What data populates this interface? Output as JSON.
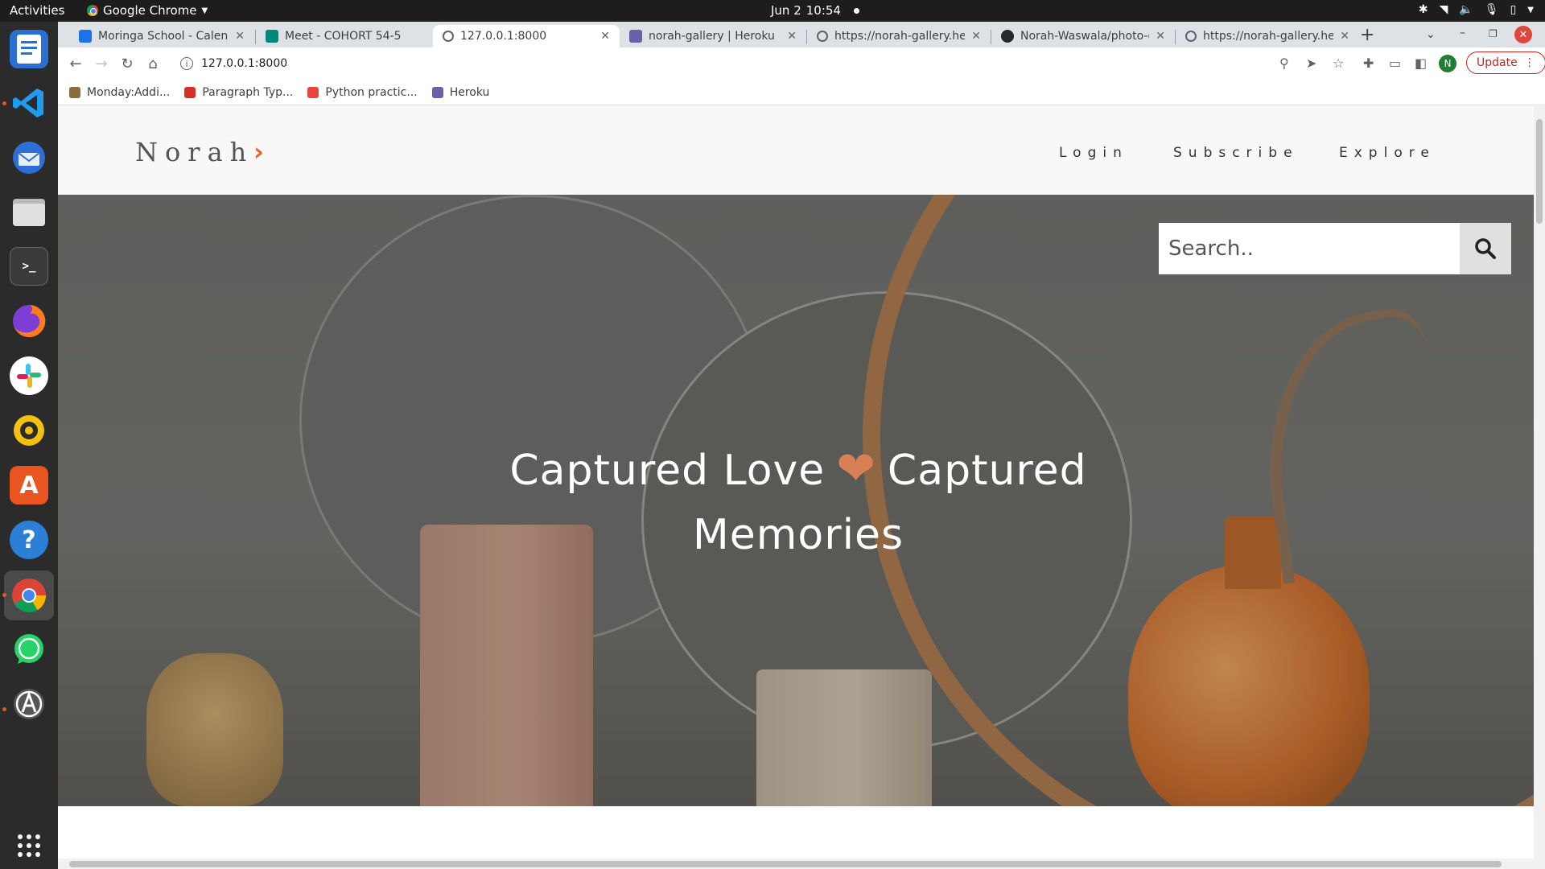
{
  "system_bar": {
    "activities": "Activities",
    "app_name": "Google Chrome",
    "date": "Jun 2",
    "time": "10:54"
  },
  "dock": {
    "apps": [
      "libreoffice-writer-icon",
      "vscode-icon",
      "thunderbird-icon",
      "files-icon",
      "terminal-icon",
      "firefox-icon",
      "slack-icon",
      "rhythmbox-icon",
      "software-center-icon",
      "help-icon",
      "chrome-icon",
      "whatsapp-icon",
      "software-updater-icon"
    ],
    "show_apps": "show-applications-icon"
  },
  "browser": {
    "tabs": [
      {
        "title": "Moringa School - Calendar",
        "favicon_color": "#1a73e8",
        "active": false
      },
      {
        "title": "Meet - COHORT 54-5",
        "favicon_color": "#00897b",
        "active": false,
        "recording": true
      },
      {
        "title": "127.0.0.1:8000",
        "favicon_color": "#5f6368",
        "active": true
      },
      {
        "title": "norah-gallery | Heroku",
        "favicon_color": "#6762a6",
        "active": false
      },
      {
        "title": "https://norah-gallery.herokuapp.com",
        "favicon_color": "#5f6368",
        "active": false
      },
      {
        "title": "Norah-Waswala/photo-gallery",
        "favicon_color": "#24292e",
        "active": false
      },
      {
        "title": "https://norah-gallery.herokuapp.com",
        "favicon_color": "#5f6368",
        "active": false
      }
    ],
    "url": "127.0.0.1:8000",
    "update_label": "Update",
    "profile_initial": "N",
    "bookmarks": [
      {
        "label": "Monday:Addi...",
        "color": "#8a6d3b"
      },
      {
        "label": "Paragraph Typ...",
        "color": "#d93025"
      },
      {
        "label": "Python practic...",
        "color": "#e8453c"
      },
      {
        "label": "Heroku",
        "color": "#6762a6"
      }
    ]
  },
  "site": {
    "brand": "Norah",
    "nav": [
      "Login",
      "Subscribe",
      "Explore"
    ],
    "search_placeholder": "Search..",
    "hero_line1_left": "Captured Love",
    "hero_line1_right": "Captured",
    "hero_line2": "Memories",
    "colors": {
      "accent": "#e8602c",
      "heart": "#d98056",
      "header_bg": "#f8f8f8"
    }
  }
}
